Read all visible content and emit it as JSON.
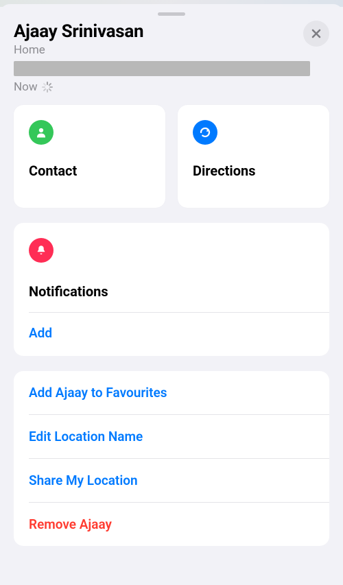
{
  "header": {
    "title": "Ajaay Srinivasan",
    "subtitle": "Home",
    "now_label": "Now"
  },
  "cards": {
    "contact_label": "Contact",
    "directions_label": "Directions"
  },
  "notifications": {
    "title": "Notifications",
    "add_label": "Add"
  },
  "actions": {
    "favourites": "Add Ajaay to Favourites",
    "edit_name": "Edit Location Name",
    "share_loc": "Share My Location",
    "remove": "Remove Ajaay"
  }
}
